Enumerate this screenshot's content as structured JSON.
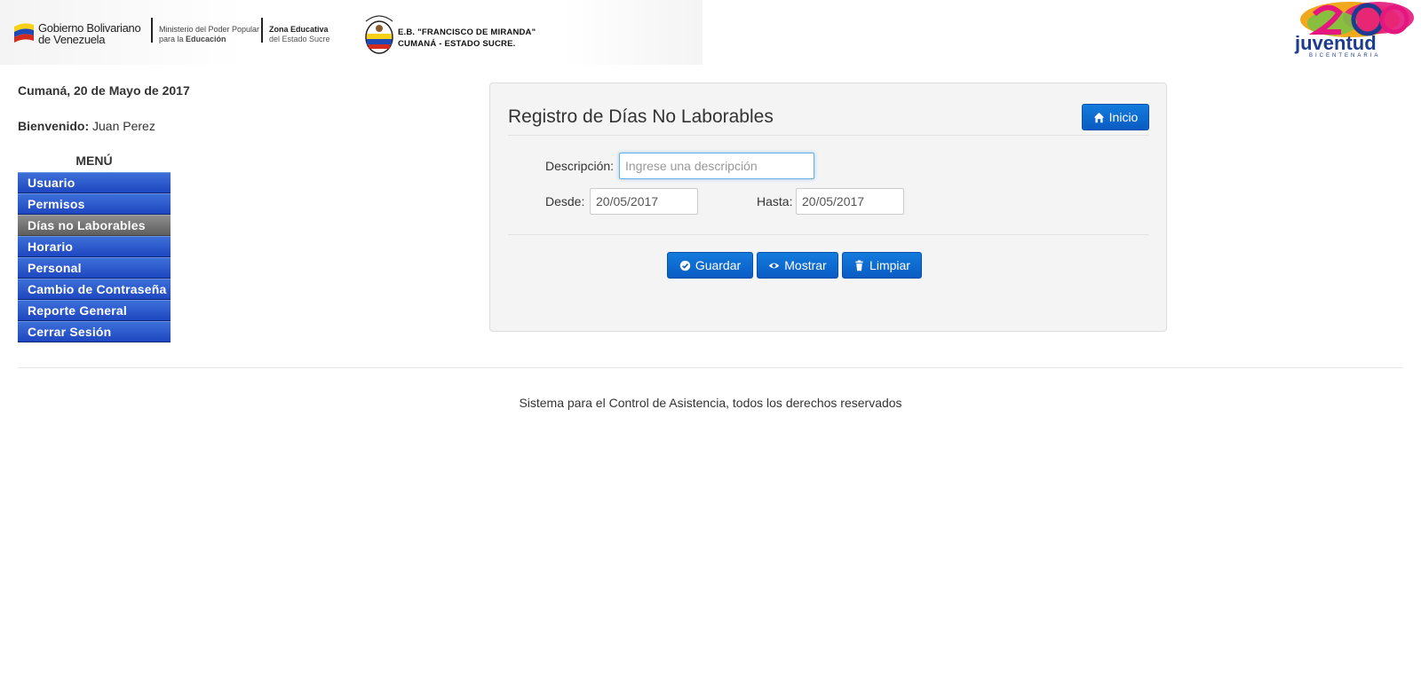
{
  "header": {
    "gov_line1": "Gobierno Bolivariano",
    "gov_line2": "de Venezuela",
    "ministry_line1": "Ministerio del Poder Popular",
    "ministry_line2_prefix": "para la ",
    "ministry_line2_bold": "Educación",
    "zone_line1": "Zona Educativa",
    "zone_line2": "del Estado Sucre",
    "school_line1": "E.B. \"FRANCISCO DE MIRANDA\"",
    "school_line2": "CUMANÁ - ESTADO SUCRE.",
    "logo_right": "Juventud Bicentenaria 200"
  },
  "sidebar": {
    "date": "Cumaná, 20 de Mayo de 2017",
    "welcome_label": "Bienvenido:",
    "user_name": " Juan Perez",
    "menu_title": "MENÚ",
    "items": [
      {
        "label": "Usuario",
        "active": false
      },
      {
        "label": "Permisos",
        "active": false
      },
      {
        "label": "Días no Laborables",
        "active": true
      },
      {
        "label": "Horario",
        "active": false
      },
      {
        "label": "Personal",
        "active": false
      },
      {
        "label": "Cambio de Contraseña",
        "active": false
      },
      {
        "label": "Reporte General",
        "active": false
      },
      {
        "label": "Cerrar Sesión",
        "active": false
      }
    ]
  },
  "form": {
    "title": "Registro de Días No Laborables",
    "home_button": "Inicio",
    "description_label": "Descripción:",
    "description_value": "",
    "description_placeholder": "Ingrese una descripción",
    "from_label": "Desde:",
    "from_value": "20/05/2017",
    "to_label": "Hasta:",
    "to_value": "20/05/2017",
    "save_button": "Guardar",
    "show_button": "Mostrar",
    "clear_button": "Limpiar"
  },
  "footer": {
    "text": "Sistema para el Control de Asistencia, todos los derechos reservados"
  },
  "colors": {
    "menu_blue": "#2a55cc",
    "menu_active": "#7a7a7a",
    "button_blue": "#0a62c8"
  }
}
